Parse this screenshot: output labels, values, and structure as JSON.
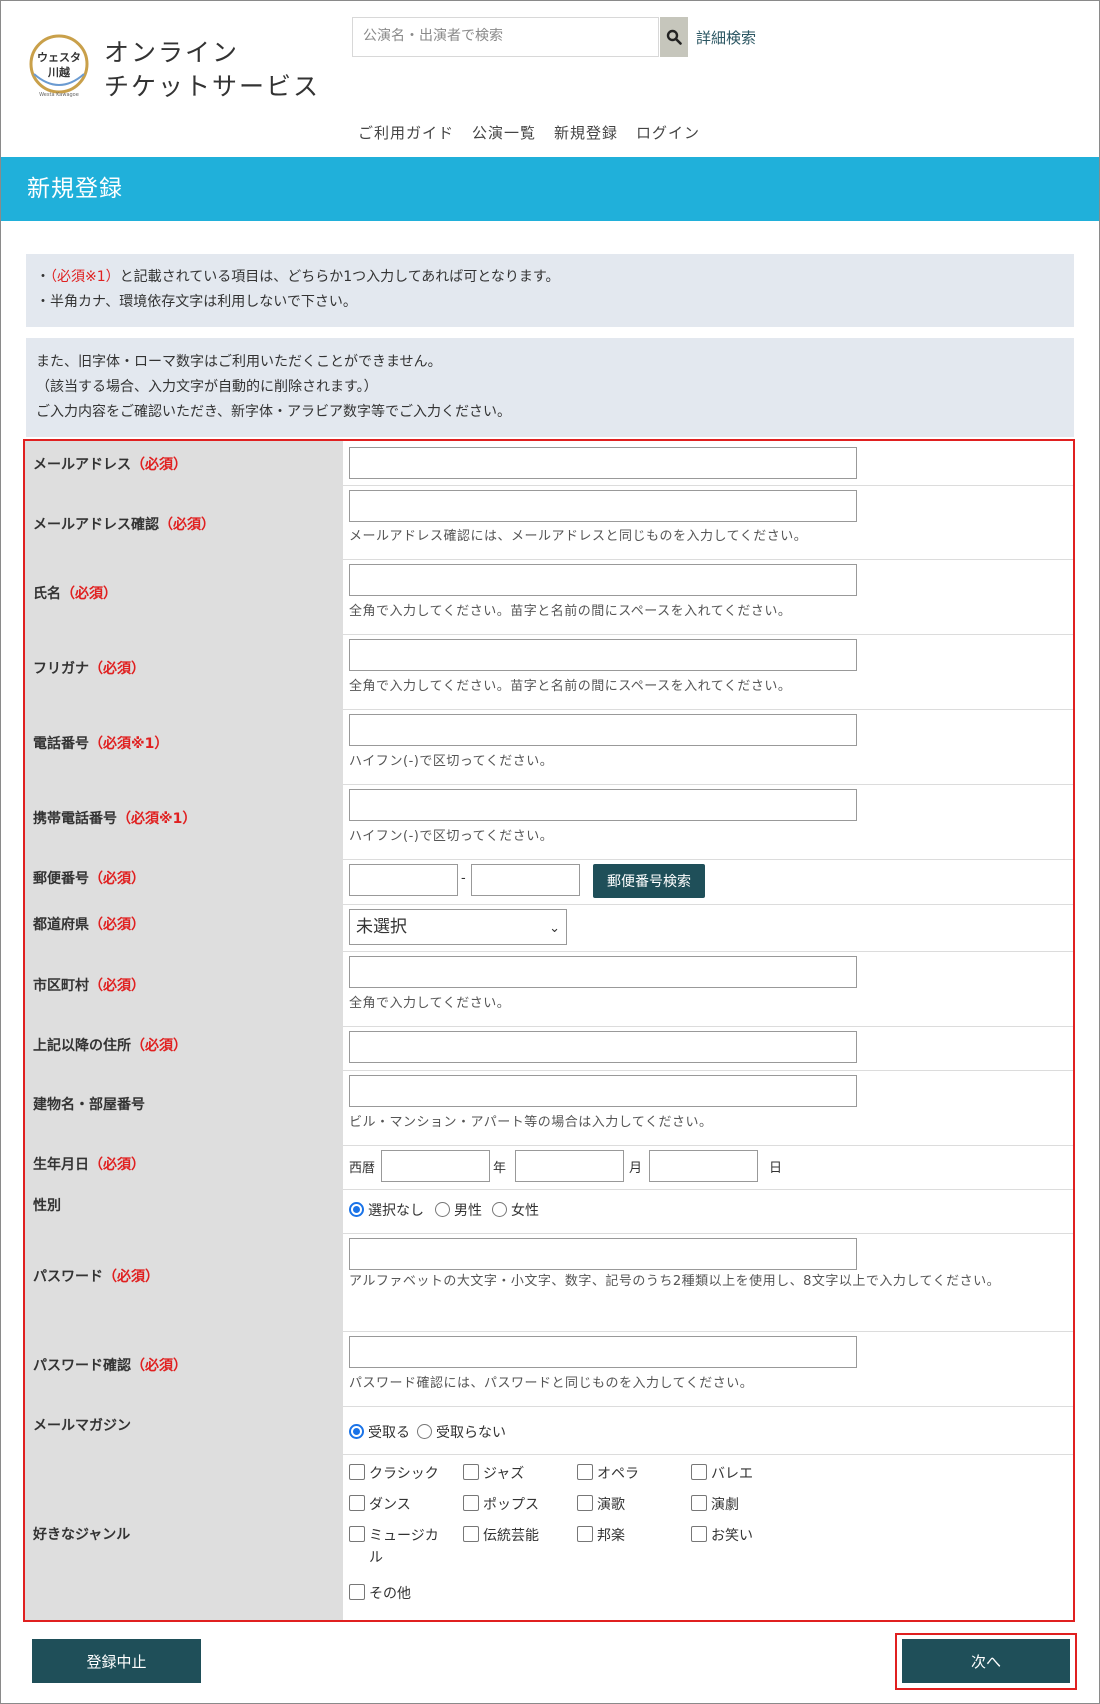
{
  "header": {
    "logo_text_top": "ウェスタ",
    "logo_text_bottom": "川越",
    "logo_sub": "Westa Kawagoe",
    "site_title": "オンライン\nチケットサービス",
    "search_placeholder": "公演名・出演者で検索",
    "advanced_search": "詳細検索",
    "nav": [
      "ご利用ガイド",
      "公演一覧",
      "新規登録",
      "ログイン"
    ]
  },
  "page_title": "新規登録",
  "notices": {
    "n1_prefix": "・",
    "n1_req": "（必須※1）",
    "n1_rest": "と記載されている項目は、どちらか1つ入力してあれば可となります。",
    "n1_line2": "・半角カナ、環境依存文字は利用しないで下さい。",
    "n2_lines": [
      "また、旧字体・ローマ数字はご利用いただくことができません。",
      "（該当する場合、入力文字が自動的に削除されます。）",
      "ご入力内容をご確認いただき、新字体・アラビア数字等でご入力ください。"
    ]
  },
  "form": {
    "req": "（必須）",
    "req1": "（必須※1）",
    "email": "メールアドレス",
    "email_confirm": "メールアドレス確認",
    "email_confirm_hint": "メールアドレス確認には、メールアドレスと同じものを入力してください。",
    "name": "氏名",
    "name_hint": "全角で入力してください。苗字と名前の間にスペースを入れてください。",
    "kana": "フリガナ",
    "kana_hint": "全角で入力してください。苗字と名前の間にスペースを入れてください。",
    "phone": "電話番号",
    "phone_hint": "ハイフン(-)で区切ってください。",
    "mobile": "携帯電話番号",
    "mobile_hint": "ハイフン(-)で区切ってください。",
    "zip": "郵便番号",
    "zip_sep": "-",
    "zip_search": "郵便番号検索",
    "pref": "都道府県",
    "pref_value": "未選択",
    "city": "市区町村",
    "city_hint": "全角で入力してください。",
    "address": "上記以降の住所",
    "building": "建物名・部屋番号",
    "building_hint": "ビル・マンション・アパート等の場合は入力してください。",
    "birth": "生年月日",
    "birth_era": "西暦",
    "birth_year": "年",
    "birth_month": "月",
    "birth_day": "日",
    "gender": "性別",
    "gender_options": [
      "選択なし",
      "男性",
      "女性"
    ],
    "password": "パスワード",
    "password_hint": "アルファベットの大文字・小文字、数字、記号のうち2種類以上を使用し、8文字以上で入力してください。",
    "password_confirm": "パスワード確認",
    "password_confirm_hint": "パスワード確認には、パスワードと同じものを入力してください。",
    "magazine": "メールマガジン",
    "magazine_options": [
      "受取る",
      "受取らない"
    ],
    "genre": "好きなジャンル",
    "genres": [
      "クラシック",
      "ジャズ",
      "オペラ",
      "バレエ",
      "ダンス",
      "ポップス",
      "演歌",
      "演劇",
      "ミュージカル",
      "伝統芸能",
      "邦楽",
      "お笑い",
      "その他"
    ]
  },
  "buttons": {
    "cancel": "登録中止",
    "next": "次へ"
  },
  "colors": {
    "title_bar": "#20b0da",
    "button": "#1f4f59",
    "required": "#e02020",
    "notice_bg": "#e3e8ef"
  }
}
